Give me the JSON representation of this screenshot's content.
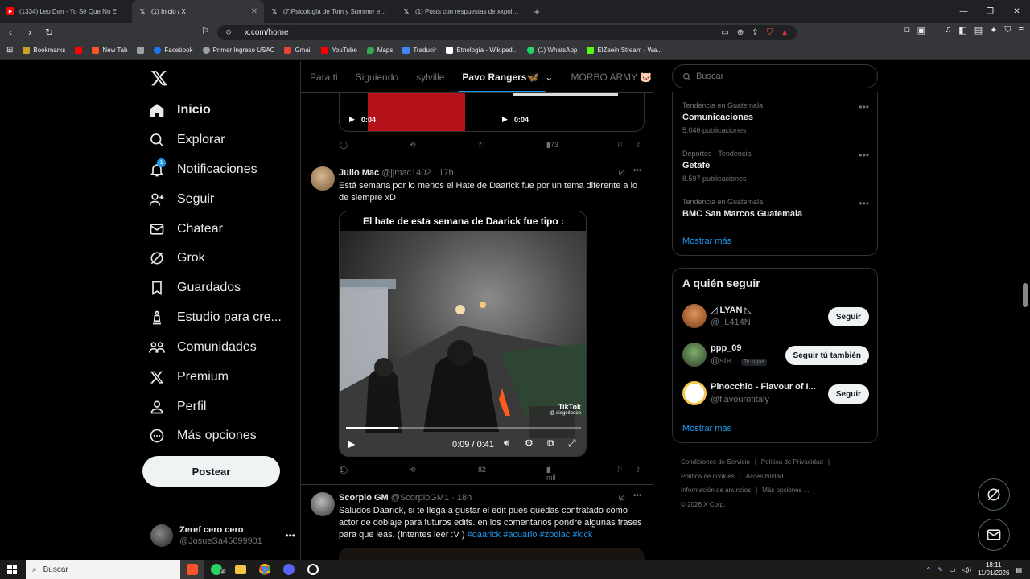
{
  "browser": {
    "tabs": [
      {
        "title": "(1334) Leo Dan - Yo Sé Que No E",
        "icon": "youtube-icon",
        "color": "#ff0000"
      },
      {
        "title": "(1) Inicio / X",
        "icon": "x-icon",
        "active": true
      },
      {
        "title": "(7)Psicología de Tom y Summer en \"5",
        "icon": "x-icon"
      },
      {
        "title": "(1) Posts con respuestas de xxpolar (",
        "icon": "x-icon"
      }
    ],
    "url": "x.com/home",
    "bookmarks": [
      {
        "label": "Bookmarks",
        "icon": "folder-icon",
        "color": "#c9a227"
      },
      {
        "label": "",
        "icon": "youtube-icon",
        "color": "#ff0000"
      },
      {
        "label": "New Tab",
        "icon": "brave-icon",
        "color": "#fb542b"
      },
      {
        "label": "",
        "icon": "image-icon",
        "color": "#9aa0a6"
      },
      {
        "label": "Facebook",
        "icon": "facebook-icon",
        "color": "#1877f2"
      },
      {
        "label": "Primer Ingreso USAC",
        "icon": "globe-icon",
        "color": "#9aa0a6"
      },
      {
        "label": "Gmail",
        "icon": "gmail-icon",
        "color": "#ea4335"
      },
      {
        "label": "YouTube",
        "icon": "youtube-icon",
        "color": "#ff0000"
      },
      {
        "label": "Maps",
        "icon": "maps-icon",
        "color": "#34a853"
      },
      {
        "label": "Traducir",
        "icon": "translate-icon",
        "color": "#4285f4"
      },
      {
        "label": "Etnología - Wikiped...",
        "icon": "wikipedia-icon",
        "color": "#ffffff"
      },
      {
        "label": "(1) WhatsApp",
        "icon": "whatsapp-icon",
        "color": "#25d366"
      },
      {
        "label": "ElZeein Stream - Wa...",
        "icon": "kick-icon",
        "color": "#53fc18"
      }
    ]
  },
  "sidebar": {
    "nav": [
      {
        "label": "Inicio",
        "icon": "home-icon",
        "bold": true
      },
      {
        "label": "Explorar",
        "icon": "search-icon"
      },
      {
        "label": "Notificaciones",
        "icon": "bell-icon",
        "badge": "1"
      },
      {
        "label": "Seguir",
        "icon": "person-add-icon"
      },
      {
        "label": "Chatear",
        "icon": "mail-icon"
      },
      {
        "label": "Grok",
        "icon": "grok-icon"
      },
      {
        "label": "Guardados",
        "icon": "bookmark-icon"
      },
      {
        "label": "Estudio para cre...",
        "icon": "flask-icon"
      },
      {
        "label": "Comunidades",
        "icon": "communities-icon"
      },
      {
        "label": "Premium",
        "icon": "x-icon"
      },
      {
        "label": "Perfil",
        "icon": "profile-icon"
      },
      {
        "label": "Más opciones",
        "icon": "more-circle-icon"
      }
    ],
    "post_label": "Postear",
    "account": {
      "name": "Zeref cero cero",
      "handle": "@JosueSa45699901"
    }
  },
  "feed": {
    "tabs": [
      "Para ti",
      "Siguiendo",
      "sylville",
      "Pavo Rangers🦋",
      "MORBO ARMY 🐷"
    ],
    "active_tab": 3,
    "prev_tweet": {
      "video1_time": "0:04",
      "video2_time": "0:04",
      "replies": "",
      "likes": "7",
      "views": "473"
    },
    "tweet": {
      "name": "Julio Mac",
      "handle": "@jjmac1402",
      "time": "· 17h",
      "text": "Está semana por lo menos el Hate de Daarick fue por un tema diferente a lo de siempre xD",
      "video_caption": "El hate de esta semana de Daarick fue tipo :",
      "video_time": "0:09 / 0:41",
      "video_progress": 0.22,
      "tiktok_label": "TikTok",
      "tiktok_user": "@ diegoitooop",
      "replies": "1",
      "likes": "82",
      "views": "4 mil"
    },
    "tweet2": {
      "name": "Scorpio GM",
      "handle": "@ScorpioGM1",
      "time": "· 18h",
      "text": "Saludos Daarick, si te llega a gustar el edit pues quedas contratado como actor de doblaje para futuros edits. en los comentarios pondré algunas frases para que leas. (intentes leer :V )",
      "hashtags": "#daarick #acuario #zodiac #kick"
    }
  },
  "right": {
    "search_placeholder": "Buscar",
    "trends": [
      {
        "meta": "Tendencia en Guatemala",
        "name": "Comunicaciones",
        "count": "5.046 publicaciones"
      },
      {
        "meta": "Deportes · Tendencia",
        "name": "Getafe",
        "count": "8.597 publicaciones"
      },
      {
        "meta": "Tendencia en Guatemala",
        "name": "BMC San Marcos Guatemala",
        "count": ""
      }
    ],
    "show_more": "Mostrar más",
    "who_to_follow_title": "A quién seguir",
    "who_to_follow": [
      {
        "name": "◿ LYAN ◺",
        "handle": "@_L414N",
        "button": "Seguir"
      },
      {
        "name": "ppp_09",
        "handle": "@ste...",
        "badge": "Te sigue",
        "button": "Seguir tú también"
      },
      {
        "name": "Pinocchio - Flavour of I...",
        "handle": "@flavourofitaly",
        "button": "Seguir"
      }
    ],
    "footer": [
      "Condiciones de Servicio",
      "|",
      "Política de Privacidad",
      "|",
      "Política de cookies",
      "|",
      "Accesibilidad",
      "|",
      "Información de anuncios",
      "|",
      "Más opciones ...",
      "© 2026 X Corp."
    ]
  },
  "taskbar": {
    "search_placeholder": "Buscar",
    "time": "18:11",
    "date": "11/01/2026",
    "whatsapp_badge": "2"
  }
}
